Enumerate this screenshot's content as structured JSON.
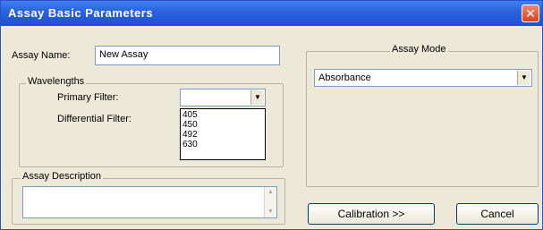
{
  "window": {
    "title": "Assay Basic Parameters",
    "close_symbol": "✕"
  },
  "assay_name": {
    "label": "Assay Name:",
    "value": "New Assay"
  },
  "wavelengths": {
    "legend": "Wavelengths",
    "primary_filter_label": "Primary Filter:",
    "primary_filter_value": "",
    "differential_filter_label": "Differential Filter:",
    "options": [
      "405",
      "450",
      "492",
      "630"
    ]
  },
  "assay_description": {
    "legend": "Assay Description",
    "value": ""
  },
  "assay_mode": {
    "legend": "Assay Mode",
    "selected": "Absorbance"
  },
  "buttons": {
    "calibration": "Calibration  >>",
    "cancel": "Cancel"
  },
  "icons": {
    "dropdown_arrow": "▼",
    "scroll_up": "▲",
    "scroll_down": "▼"
  }
}
